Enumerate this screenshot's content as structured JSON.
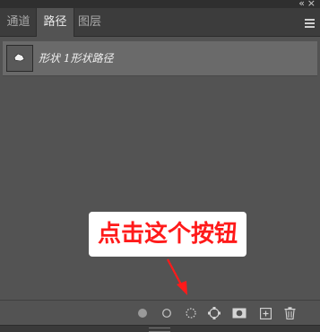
{
  "window": {
    "collapse_glyph": "«",
    "close_glyph": "×"
  },
  "tabs": [
    {
      "label": "通道",
      "active": false
    },
    {
      "label": "路径",
      "active": true
    },
    {
      "label": "图层",
      "active": false
    }
  ],
  "paths": [
    {
      "name": "形状 1形状路径",
      "selected": true
    }
  ],
  "annotation": {
    "text": "点击这个按钮",
    "color": "#ff1a1a"
  },
  "toolbar": {
    "icons": [
      "fill-path-icon",
      "stroke-path-icon",
      "load-as-selection-icon",
      "make-work-path-icon",
      "add-mask-icon",
      "new-path-icon",
      "delete-path-icon"
    ]
  },
  "colors": {
    "panel_bg": "#535353",
    "tabbar_bg": "#3c3c3c",
    "selected_row": "#6a6a6a",
    "icon_color": "#d4d4d4"
  }
}
